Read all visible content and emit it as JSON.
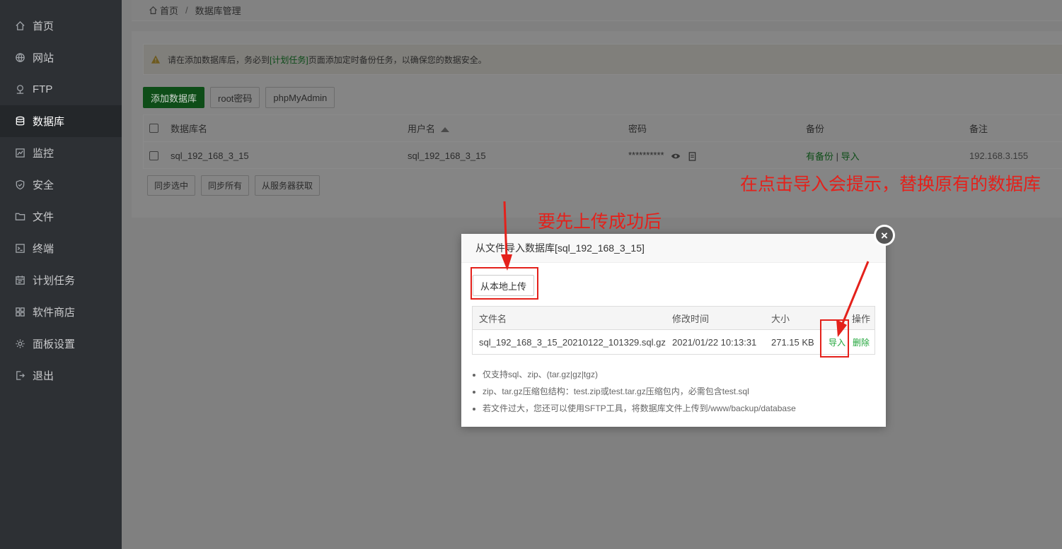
{
  "sidebar": {
    "items": [
      {
        "label": "首页",
        "icon": "home-icon",
        "active": false
      },
      {
        "label": "网站",
        "icon": "globe-icon",
        "active": false
      },
      {
        "label": "FTP",
        "icon": "ftp-icon",
        "active": false
      },
      {
        "label": "数据库",
        "icon": "database-icon",
        "active": true
      },
      {
        "label": "监控",
        "icon": "monitor-icon",
        "active": false
      },
      {
        "label": "安全",
        "icon": "shield-icon",
        "active": false
      },
      {
        "label": "文件",
        "icon": "folder-icon",
        "active": false
      },
      {
        "label": "终端",
        "icon": "terminal-icon",
        "active": false
      },
      {
        "label": "计划任务",
        "icon": "calendar-icon",
        "active": false
      },
      {
        "label": "软件商店",
        "icon": "apps-icon",
        "active": false
      },
      {
        "label": "面板设置",
        "icon": "gear-icon",
        "active": false
      },
      {
        "label": "退出",
        "icon": "logout-icon",
        "active": false
      }
    ]
  },
  "breadcrumb": {
    "home": "首页",
    "separator": "/",
    "current": "数据库管理"
  },
  "alert": {
    "before": "请在添加数据库后，务必到",
    "link": "[计划任务]",
    "after": "页面添加定时备份任务，以确保您的数据安全。"
  },
  "toolbar": {
    "add_db": "添加数据库",
    "root_pwd": "root密码",
    "phpmyadmin": "phpMyAdmin"
  },
  "db_table": {
    "headers": {
      "name": "数据库名",
      "user": "用户名",
      "password": "密码",
      "backup": "备份",
      "note": "备注"
    },
    "rows": [
      {
        "name": "sql_192_168_3_15",
        "user": "sql_192_168_3_15",
        "password": "**********",
        "backup_status": "有备份",
        "backup_sep": "|",
        "import": "导入",
        "note": "192.168.3.155"
      }
    ]
  },
  "sync": {
    "selected": "同步选中",
    "all": "同步所有",
    "from_server": "从服务器获取"
  },
  "modal": {
    "title": "从文件导入数据库[sql_192_168_3_15]",
    "upload_button": "从本地上传",
    "table_headers": {
      "filename": "文件名",
      "mtime": "修改时间",
      "size": "大小",
      "ops": "操作"
    },
    "files": [
      {
        "filename": "sql_192_168_3_15_20210122_101329.sql.gz",
        "mtime": "2021/01/22 10:13:31",
        "size": "271.15 KB",
        "import": "导入",
        "delete": "删除"
      }
    ],
    "notes": [
      "仅支持sql、zip、(tar.gz|gz|tgz)",
      "zip、tar.gz压缩包结构：test.zip或test.tar.gz压缩包内，必需包含test.sql",
      "若文件过大，您还可以使用SFTP工具，将数据库文件上传到/www/backup/database"
    ]
  },
  "annotations": {
    "upload_first": "要先上传成功后",
    "import_hint": "在点击导入会提示，替换原有的数据库",
    "color": "#e4211b"
  }
}
